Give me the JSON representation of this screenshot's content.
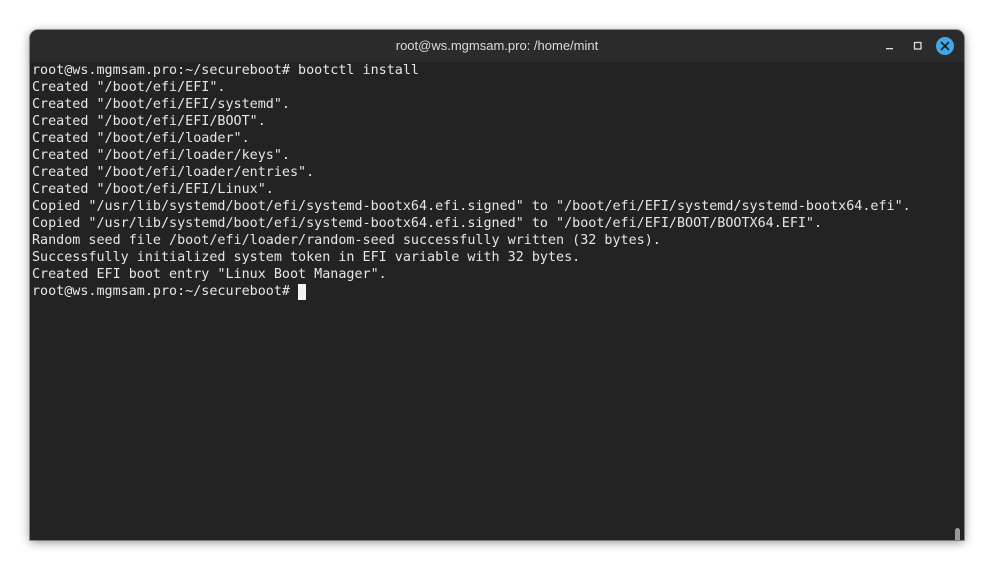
{
  "window": {
    "title": "root@ws.mgmsam.pro: /home/mint"
  },
  "icons": {
    "minimize": "minimize-icon",
    "maximize": "maximize-icon",
    "close": "close-icon"
  },
  "colors": {
    "terminal_bg": "#232323",
    "titlebar_bg": "#2b2b2b",
    "text": "#e6e6e6",
    "close_button": "#3fa9ec"
  },
  "terminal": {
    "lines": [
      "root@ws.mgmsam.pro:~/secureboot# bootctl install",
      "Created \"/boot/efi/EFI\".",
      "Created \"/boot/efi/EFI/systemd\".",
      "Created \"/boot/efi/EFI/BOOT\".",
      "Created \"/boot/efi/loader\".",
      "Created \"/boot/efi/loader/keys\".",
      "Created \"/boot/efi/loader/entries\".",
      "Created \"/boot/efi/EFI/Linux\".",
      "Copied \"/usr/lib/systemd/boot/efi/systemd-bootx64.efi.signed\" to \"/boot/efi/EFI/systemd/systemd-bootx64.efi\".",
      "Copied \"/usr/lib/systemd/boot/efi/systemd-bootx64.efi.signed\" to \"/boot/efi/EFI/BOOT/BOOTX64.EFI\".",
      "Random seed file /boot/efi/loader/random-seed successfully written (32 bytes).",
      "Successfully initialized system token in EFI variable with 32 bytes.",
      "Created EFI boot entry \"Linux Boot Manager\"."
    ],
    "prompt": "root@ws.mgmsam.pro:~/secureboot#"
  }
}
